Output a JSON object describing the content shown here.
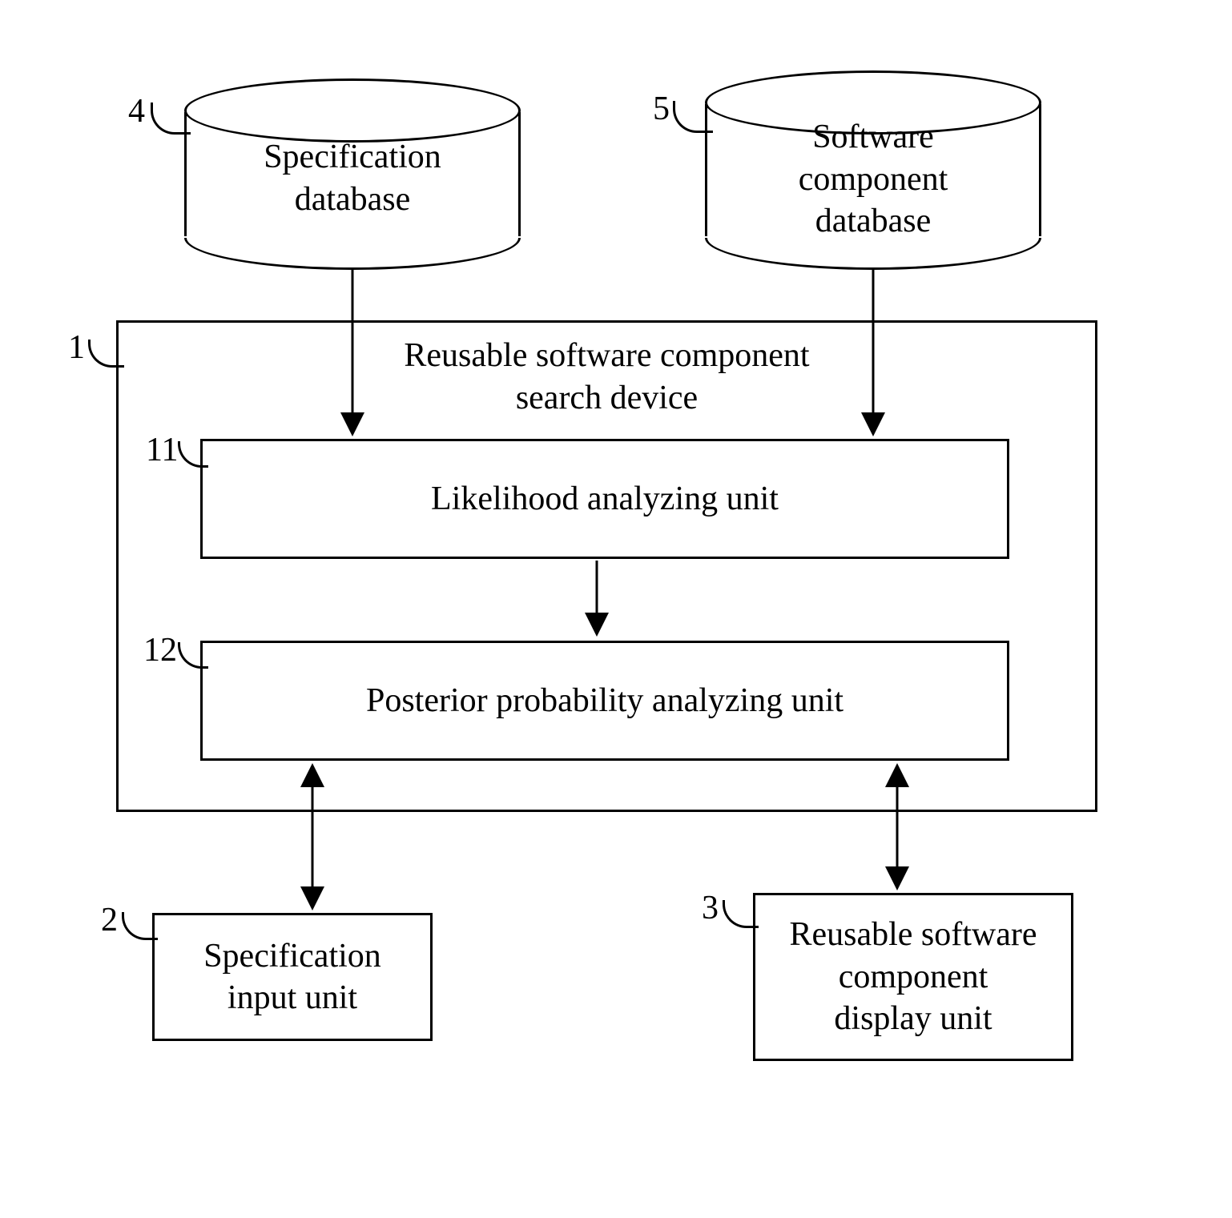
{
  "nodes": {
    "spec_db": {
      "num": "4",
      "label": "Specification\ndatabase"
    },
    "sw_db": {
      "num": "5",
      "label": "Software\ncomponent\ndatabase"
    },
    "device": {
      "num": "1",
      "label": "Reusable software component\nsearch device"
    },
    "likelihood": {
      "num": "11",
      "label": "Likelihood analyzing unit"
    },
    "posterior": {
      "num": "12",
      "label": "Posterior probability analyzing unit"
    },
    "input_unit": {
      "num": "2",
      "label": "Specification\ninput unit"
    },
    "display_unit": {
      "num": "3",
      "label": "Reusable software\ncomponent\ndisplay unit"
    }
  }
}
